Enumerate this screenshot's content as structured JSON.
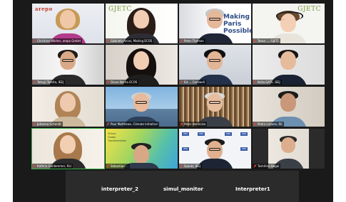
{
  "tiles": [
    {
      "name": "Christine Wörlen, arepo GmbH",
      "logo": "arepo",
      "logo_color": "#c0392b"
    },
    {
      "name": "Gabriela Arcos, Making ECOS",
      "logo": "GJETC",
      "logo_color": "#7a9b3c"
    },
    {
      "name": "Peter Thomas",
      "logo": "",
      "logo_color": ""
    },
    {
      "name": "Tessa …, GJETC",
      "logo": "GJETC",
      "logo_color": "#7a9b3c"
    },
    {
      "name": "Tetsuji Tomita, IEEJ",
      "logo": "",
      "logo_color": ""
    },
    {
      "name": "Diana Narita ECOS",
      "logo": "",
      "logo_color": ""
    },
    {
      "name": "Ed…, Cornwell",
      "logo": "",
      "logo_color": ""
    },
    {
      "name": "Keita GATE, IEEJ",
      "logo": "",
      "logo_color": ""
    },
    {
      "name": "Johanna Schmidt",
      "logo": "",
      "logo_color": ""
    },
    {
      "name": "Paul Matthews, Climate Initiative",
      "logo": "",
      "logo_color": ""
    },
    {
      "name": "Peter Hennicke",
      "logo": "",
      "logo_color": ""
    },
    {
      "name": "Pedro Linares, RE",
      "logo": "",
      "logo_color": ""
    },
    {
      "name": "Kathrin Goldammer, RLI",
      "logo": "",
      "logo_color": ""
    },
    {
      "name": "Sebastian …",
      "logo": "",
      "logo_color": ""
    },
    {
      "name": "Suzuki, IEEJ",
      "logo": "IEEJ",
      "logo_color": "#3b5da8"
    },
    {
      "name": "Toshihiro Nagai",
      "logo": "",
      "logo_color": ""
    }
  ],
  "sign_text": {
    "line1": "Making",
    "line2": "Paris",
    "line3": "Possible"
  },
  "slide_text": {
    "line1": "Virtual",
    "line2": "Global",
    "line3": "Transformation"
  },
  "bottom_labels": {
    "left": "interpreter_2",
    "center": "simul_monitor",
    "right": "Interpreter1"
  },
  "colors": {
    "app_bg": "#1a1a1a",
    "tile_bg": "#3a3a3a",
    "speaking": "#38b24a",
    "bar_bg": "#2b2b2b",
    "mic_muted": "#e0463b"
  }
}
